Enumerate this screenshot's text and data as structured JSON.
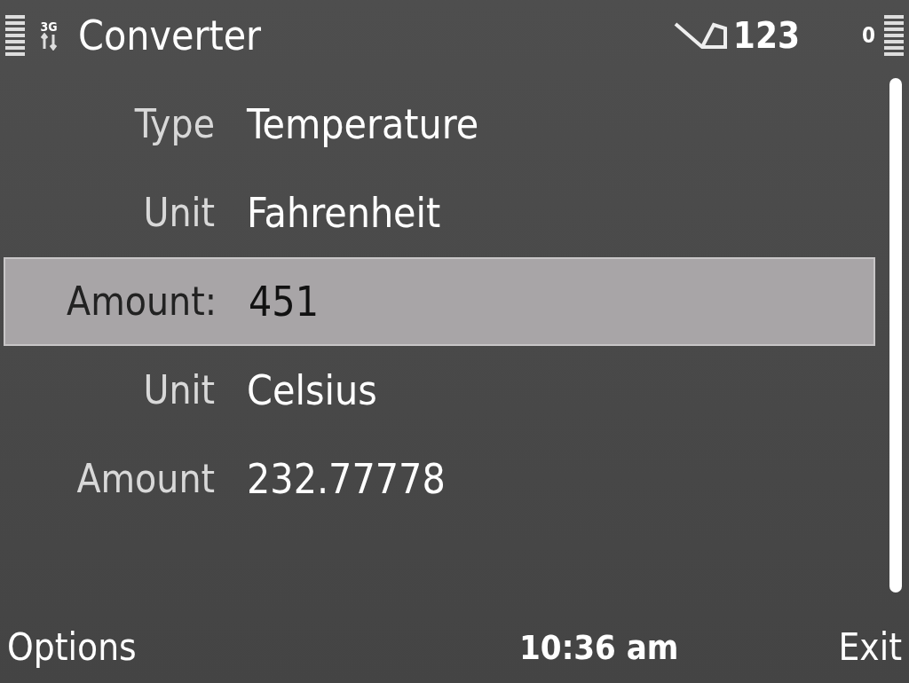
{
  "status_bar": {
    "network": "3G",
    "title": "Converter",
    "input_mode": "123",
    "indicator": "0"
  },
  "fields": [
    {
      "label": "Type",
      "value": "Temperature",
      "selected": false
    },
    {
      "label": "Unit",
      "value": "Fahrenheit",
      "selected": false
    },
    {
      "label": "Amount:",
      "value": "451",
      "selected": true
    },
    {
      "label": "Unit",
      "value": "Celsius",
      "selected": false
    },
    {
      "label": "Amount",
      "value": "232.77778",
      "selected": false
    }
  ],
  "softkeys": {
    "left": "Options",
    "clock": "10:36 am",
    "right": "Exit"
  }
}
